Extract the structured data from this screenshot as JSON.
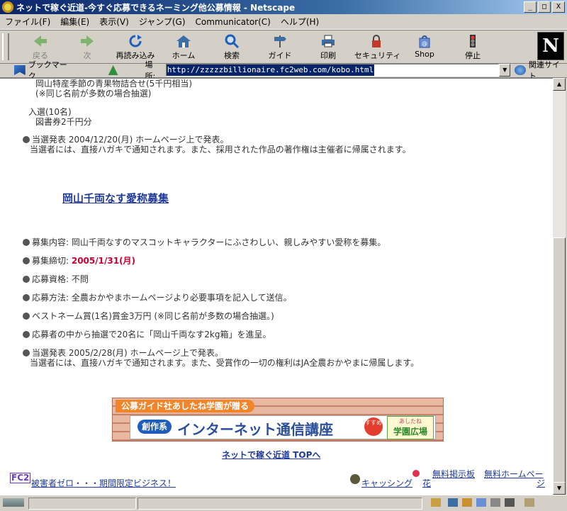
{
  "window": {
    "title": "ネットで稼ぐ近道-今すぐ応募できるネーミング他公募情報 - Netscape",
    "minimize": "_",
    "maximize": "□",
    "close": "X"
  },
  "menu": [
    "ファイル(F)",
    "編集(E)",
    "表示(V)",
    "ジャンプ(G)",
    "Communicator(C)",
    "ヘルプ(H)"
  ],
  "toolbar": {
    "back": "戻る",
    "forward": "次",
    "reload": "再読み込み",
    "home": "ホーム",
    "search": "検索",
    "guide": "ガイド",
    "print": "印刷",
    "security": "セキュリティ",
    "shop": "Shop",
    "stop": "停止",
    "logo": "N"
  },
  "location": {
    "bookmarks": "ブックマーク",
    "label": "場所:",
    "url": "http://zzzzzbillionaire.fc2web.com/kobo.html",
    "related": "関連サイト"
  },
  "content": {
    "prev_prize_line1": "岡山特産季節の青果物詰合せ(5千円相当)",
    "prev_prize_line2": "(※同じ名前が多数の場合抽選)",
    "nyusen_title": "入選(10名)",
    "nyusen_prize": "図書券2千円分",
    "prev_announce": "当選発表 2004/12/20(月) ホームページ上で発表。",
    "prev_notice": "当選者には、直接ハガキで通知されます。また、採用された作品の著作権は主催者に帰属されます。",
    "heading": "岡山千両なす愛称募集",
    "item1": "募集内容: 岡山千両なすのマスコットキャラクターにふさわしい、親しみやすい愛称を募集。",
    "item2_label": "募集締切: ",
    "item2_value": "2005/1/31(月)",
    "item3": "応募資格: 不問",
    "item4": "応募方法: 全農おかやまホームページより必要事項を記入して送信。",
    "item5": "ベストネーム賞(1名)賞金3万円 (※同じ名前が多数の場合抽選。)",
    "item6": "応募者の中から抽選で20名に「岡山千両なす2kg箱」を進呈。",
    "item7": "当選発表 2005/2/28(月) ホームページ上で発表。",
    "item7_notice": "当選者には、直接ハガキで通知されます。また、受賞作の一切の権利はJA全農おかやまに帰属します。",
    "banner_top": "公募ガイド社あしたね学園が贈る",
    "banner_badge": "創作系",
    "banner_main": "インターネット通信講座",
    "banner_rec": "すすめ",
    "banner_school_small": "あしたね",
    "banner_school": "学園広場",
    "top_link": "ネットで稼ぐ近道 TOPへ",
    "fc2": "FC2",
    "ad_link": "被害者ゼロ・・・期間限定ビジネス！",
    "caching": "キャッシング",
    "flower": "花",
    "free_board": "無料掲示板",
    "free_home_1": "無料ホームペー",
    "free_home_2": "ジ"
  }
}
